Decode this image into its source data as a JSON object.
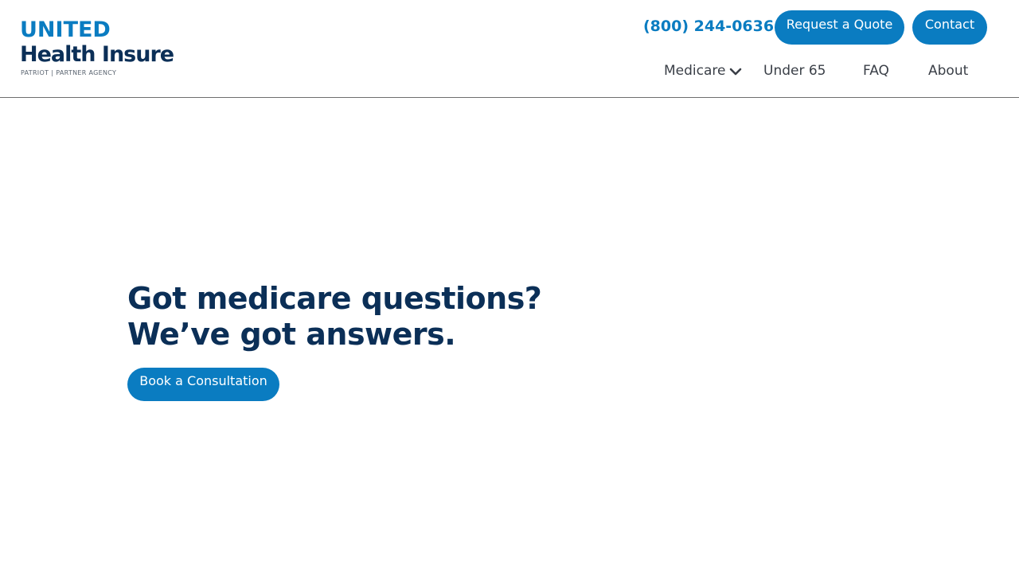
{
  "brand": {
    "line1": "UNITED",
    "line2": "Health Insure",
    "sub_left": "PATRIOT",
    "sub_sep": "|",
    "sub_right": "PARTNER AGENCY",
    "primary_color": "#0a7cc1",
    "dark_color": "#0b2f57"
  },
  "header": {
    "phone": "(800) 244-0636",
    "quote_label": "Request a Quote",
    "contact_label": "Contact"
  },
  "nav": {
    "items": [
      {
        "label": "Medicare",
        "icon": "chevron-down-icon"
      },
      {
        "label": "Under 65"
      },
      {
        "label": "FAQ"
      },
      {
        "label": "About"
      }
    ]
  },
  "hero": {
    "title_line1": "Got medicare questions?",
    "title_line2": "We’ve got answers.",
    "cta_label": "Book a Consultation"
  }
}
